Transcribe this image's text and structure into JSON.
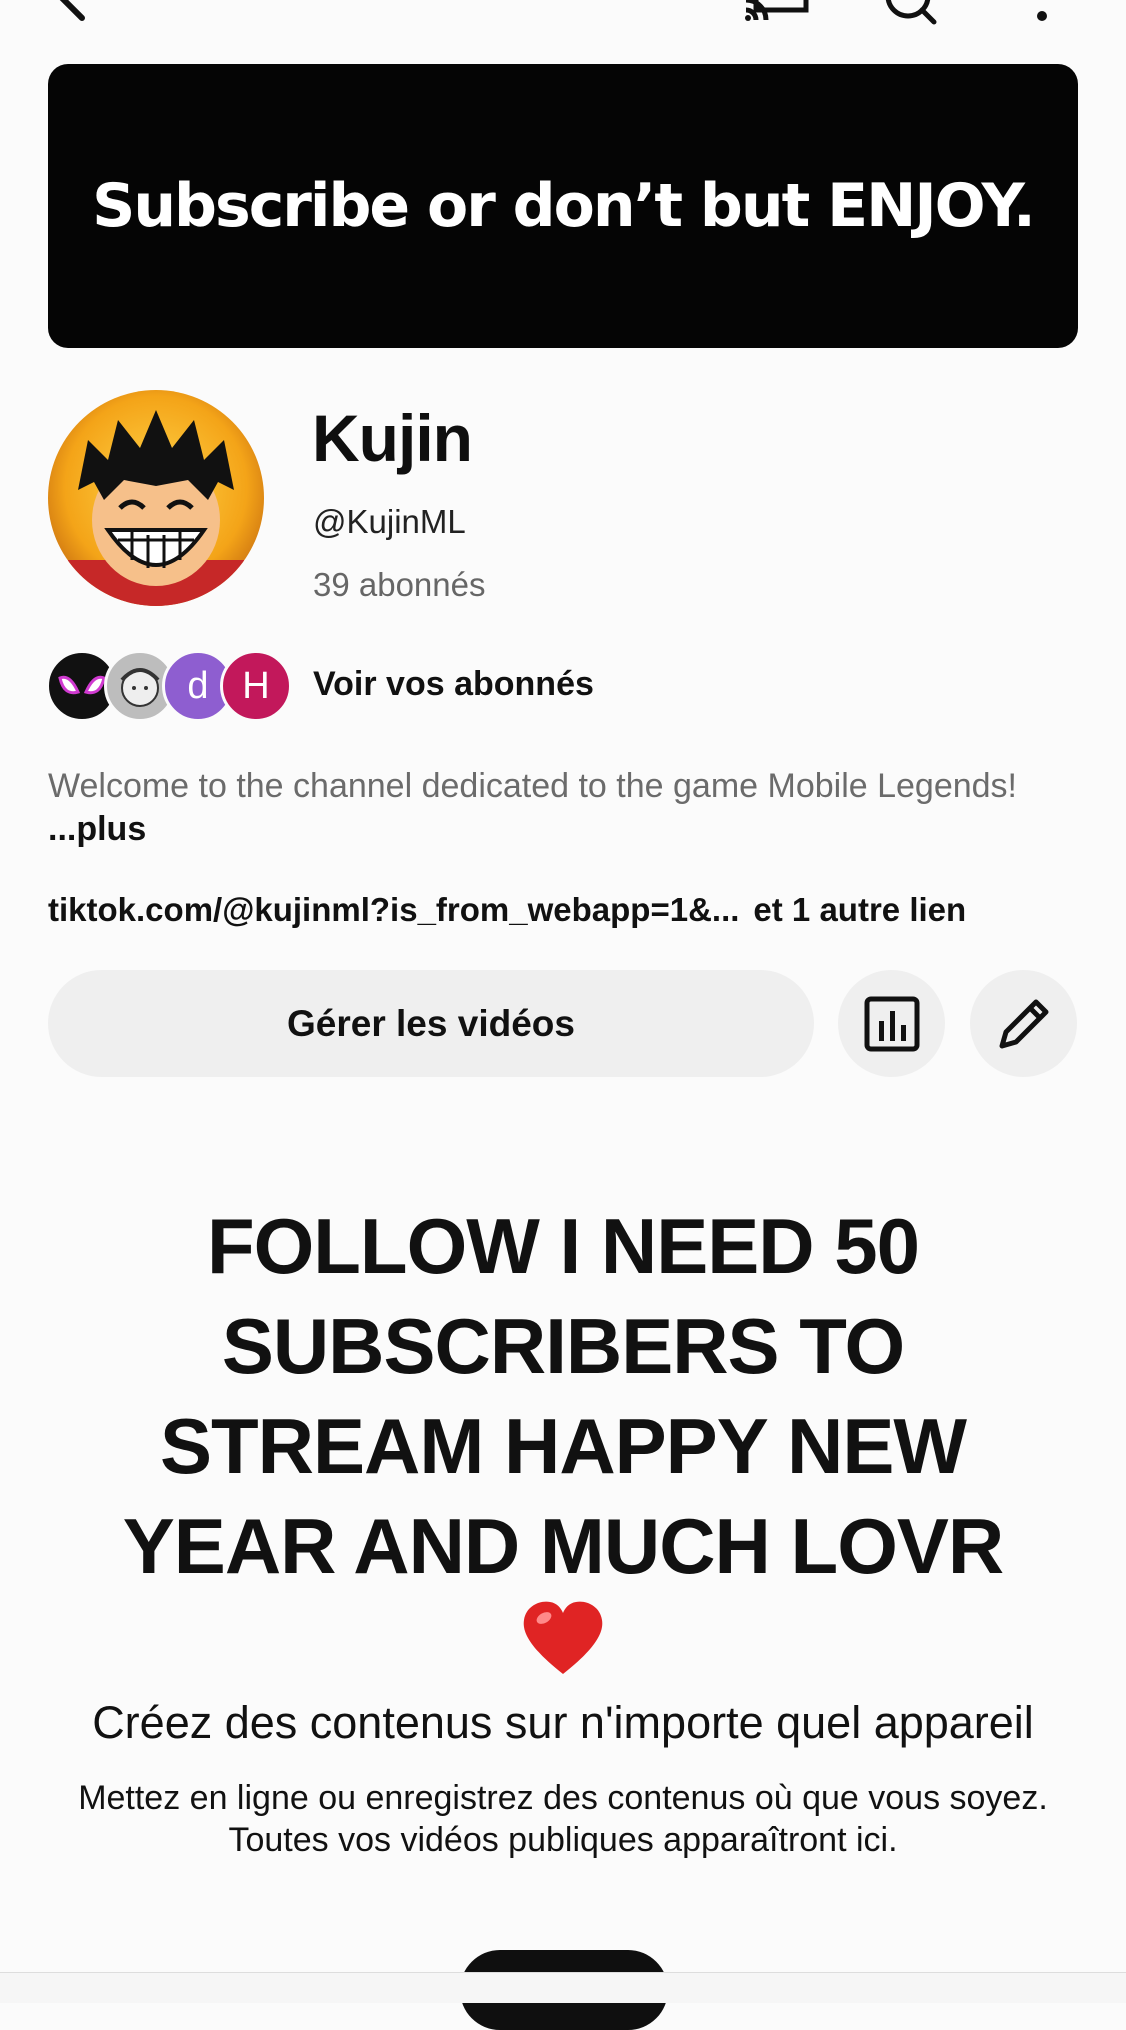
{
  "banner": {
    "text": "Subscribe or don’t but ENJOY."
  },
  "channel": {
    "name": "Kujin",
    "handle": "@KujinML",
    "subscribers": "39 abonnés"
  },
  "followers": {
    "see_label": "Voir vos abonnés",
    "avatars": [
      {
        "kind": "image",
        "icon": "spider-mask-icon",
        "color": "#111111"
      },
      {
        "kind": "image",
        "icon": "sketch-face-icon",
        "color": "#9a9a9a"
      },
      {
        "kind": "letter",
        "letter": "d",
        "color": "#8e5ed0"
      },
      {
        "kind": "letter",
        "letter": "H",
        "color": "#c2185b"
      }
    ]
  },
  "description": {
    "text": "Welcome to the channel dedicated to the game Mobile Legends!",
    "more_label": "...plus"
  },
  "links": {
    "primary": "tiktok.com/@kujinml?is_from_webapp=1&...",
    "more": "et 1 autre lien"
  },
  "actions": {
    "manage_label": "Gérer les vidéos",
    "analytics_icon": "analytics-icon",
    "edit_icon": "pencil-icon"
  },
  "headline": {
    "lines": [
      "FOLLOW I NEED 50",
      "SUBSCRIBERS TO",
      "STREAM HAPPY NEW",
      "YEAR AND MUCH LOVR"
    ],
    "emoji": "❤️"
  },
  "empty_state": {
    "title": "Créez des contenus sur n'importe quel appareil",
    "line1": "Mettez en ligne ou enregistrez des contenus où que vous soyez.",
    "line2": "Toutes vos vidéos publiques apparaîtront ici."
  },
  "topbar": {
    "icons": [
      "back-arrow-icon",
      "cast-icon",
      "search-icon",
      "more-vert-icon"
    ]
  },
  "colors": {
    "accent_red": "#e02424",
    "banner_bg": "#050505",
    "button_bg": "#efefef"
  }
}
